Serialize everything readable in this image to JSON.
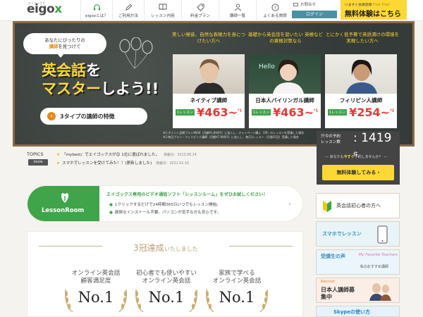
{
  "header": {
    "logo": "eigox",
    "logo_tagline": "エイゴックス",
    "nav": [
      {
        "label": "eigoxとは？",
        "icon": "headset-icon"
      },
      {
        "label": "ご利用方法",
        "icon": "pencil-icon"
      },
      {
        "label": "レッスン内容",
        "icon": "book-icon"
      },
      {
        "label": "料金プラン",
        "icon": "tag-icon"
      },
      {
        "label": "講師一覧",
        "icon": "person-icon"
      },
      {
        "label": "よくある質問",
        "icon": "question-icon"
      }
    ],
    "contact": "お問合せ",
    "login": "ログイン",
    "trial_top": "いますぐ会員登録",
    "trial_top_em": "Free Trial!",
    "trial_main": "無料体験はこちら"
  },
  "hero": {
    "bubble_line1": "あなたにぴったりの",
    "bubble_highlight": "講師",
    "bubble_line2": "を見つけて",
    "headline_line1": "英会話をマスター",
    "headline_line2": "しよう!!",
    "headline_y1": "英会話",
    "headline_w1": "を",
    "headline_y2": "マスター",
    "headline_w2": "しよう!!",
    "feature_button": "3タイプの講師の特徴",
    "cards": [
      {
        "head": "美しい発音、自然な表現力を身につけたい方へ",
        "title": "ネイティブ講師",
        "tag": "1レッスン",
        "price": "¥463~",
        "sup": "*1"
      },
      {
        "head": "基礎から英会話を習いたい 英検などの資格対策なら",
        "title": "日本人バイリンガル講師",
        "tag": "1レッスン",
        "price": "¥463~",
        "sup": "*1"
      },
      {
        "head": "とにかく低予算で英語漬けの環境を実現したい方へ",
        "title": "フィリピン人講師",
        "tag": "1レッスン",
        "price": "¥254~",
        "sup": "*2"
      }
    ],
    "fineprint_1": "※1:ポイント定期プラン¥600（月額¥1,800円）に加入し、キャンペーン購入（5P）のレッスンを受講した場合",
    "fineprint_2": "※2:毎日プラン・フィリピン人講師（月額¥7,980円）に加入し、毎日1レッスン（月間31回）受講した場合"
  },
  "counter": {
    "label_1": "只今の予約",
    "label_2": "レッスン数",
    "number": "1419",
    "unit": "件",
    "sub_pre": "あなたも",
    "sub_em": "今すぐ",
    "sub_post": "予約しませんか？",
    "button": "無料体験してみる"
  },
  "topics": {
    "title": "TOPICS",
    "more": "more",
    "items": [
      {
        "text": "『mybest』でエイゴックスが😊 1位に選ばれました。",
        "date": "掲載日：2023.06.14"
      },
      {
        "text": "スマホでレッスンを受けてみた！！(更新しました)",
        "date": "掲載日：2021.02.16"
      }
    ]
  },
  "lesson_room": {
    "logo_text": "LessonRoom",
    "title": "エイゴックス専用のビデオ通話ソフト「レッスンルーム」をぜひお試しください！",
    "lines": [
      "1クリックするだけで24時間365日いつでもレッスン開始。",
      "面倒なインストール不要。パソコンが苦手な方も安心です。"
    ]
  },
  "awards": {
    "title_main": "3冠達成",
    "title_sub": "いたしました",
    "items": [
      {
        "line1": "オンライン英会話",
        "line2": "顧客満足度",
        "rank": "No.1"
      },
      {
        "line1": "初心者でも使いやすい",
        "line2": "オンライン英会話",
        "rank": "No.1"
      },
      {
        "line1": "家族で学べる",
        "line2": "オンライン英会話",
        "rank": "No.1"
      }
    ]
  },
  "side": {
    "beginner": "英会話初心者の方へ",
    "smartphone": "スマホでレッスン",
    "voice": "受講生の声",
    "voice_sub": "My Favorite Teachers",
    "voice_sub2": "私のおすすめ講師",
    "recruit": "日本人講師募集中",
    "recruit_sub": "Recruit",
    "skype": "Skypeの使い方"
  },
  "colors": {
    "brand_green": "#3fa44a",
    "accent_yellow": "#fdd835",
    "price_red": "#e53935",
    "chalkboard": "#3d4340"
  }
}
